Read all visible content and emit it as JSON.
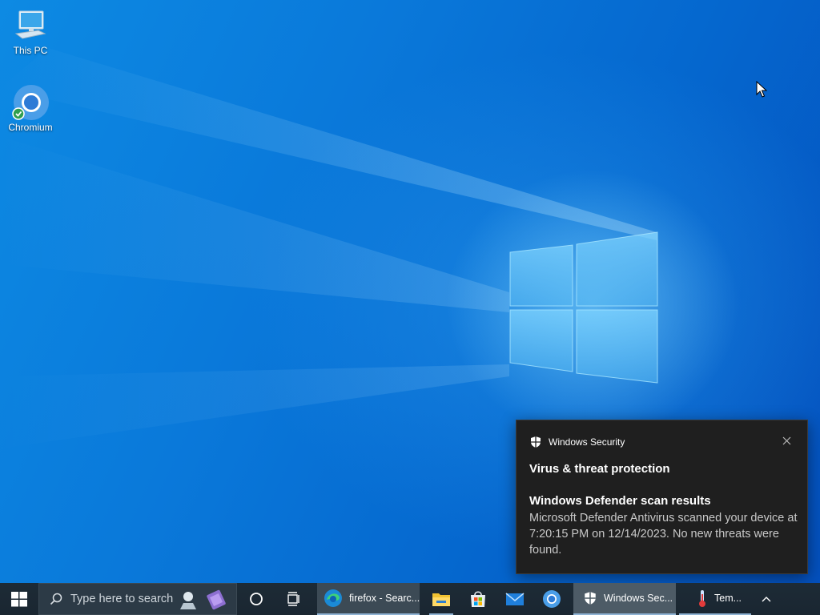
{
  "desktop": {
    "icons": [
      {
        "label": "This PC",
        "icon": "computer-icon"
      },
      {
        "label": "Chromium",
        "icon": "chromium-icon"
      }
    ]
  },
  "toast": {
    "app_name": "Windows Security",
    "title": "Virus & threat protection",
    "subtitle": "Windows Defender scan results",
    "body": "Microsoft Defender Antivirus scanned your device at 7:20:15 PM on 12/14/2023. No new threats were found.",
    "close_icon": "close-icon"
  },
  "taskbar": {
    "search_placeholder": "Type here to search",
    "apps": [
      {
        "label": "firefox - Searc...",
        "icon": "edge-icon"
      },
      {
        "label": "Windows Sec...",
        "icon": "shield-icon"
      },
      {
        "label": "Tem...",
        "icon": "thermometer-icon"
      }
    ],
    "pinned": [
      "file-explorer-icon",
      "store-icon",
      "mail-icon",
      "chromium-icon"
    ]
  },
  "colors": {
    "taskbar": "#1c2833",
    "toast_bg": "#1f1f1f",
    "accent": "#0a78d7"
  }
}
